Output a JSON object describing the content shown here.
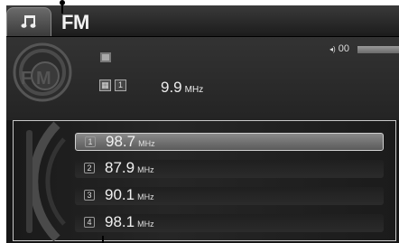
{
  "header": {
    "music_tab_icon": "music-note-icon",
    "band": "FM"
  },
  "info": {
    "logo_icon": "fm-logo-icon",
    "preset_indicator": "1",
    "frequency": "9.9",
    "frequency_unit": "MHz",
    "volume_label": "00"
  },
  "presets": [
    {
      "num": "1",
      "freq": "98.7",
      "unit": "MHz",
      "selected": true
    },
    {
      "num": "2",
      "freq": "87.9",
      "unit": "MHz",
      "selected": false
    },
    {
      "num": "3",
      "freq": "90.1",
      "unit": "MHz",
      "selected": false
    },
    {
      "num": "4",
      "freq": "98.1",
      "unit": "MHz",
      "selected": false
    }
  ],
  "colors": {
    "background": "#161616",
    "highlight": "#7a7a7a",
    "text": "#f0f0f0"
  }
}
